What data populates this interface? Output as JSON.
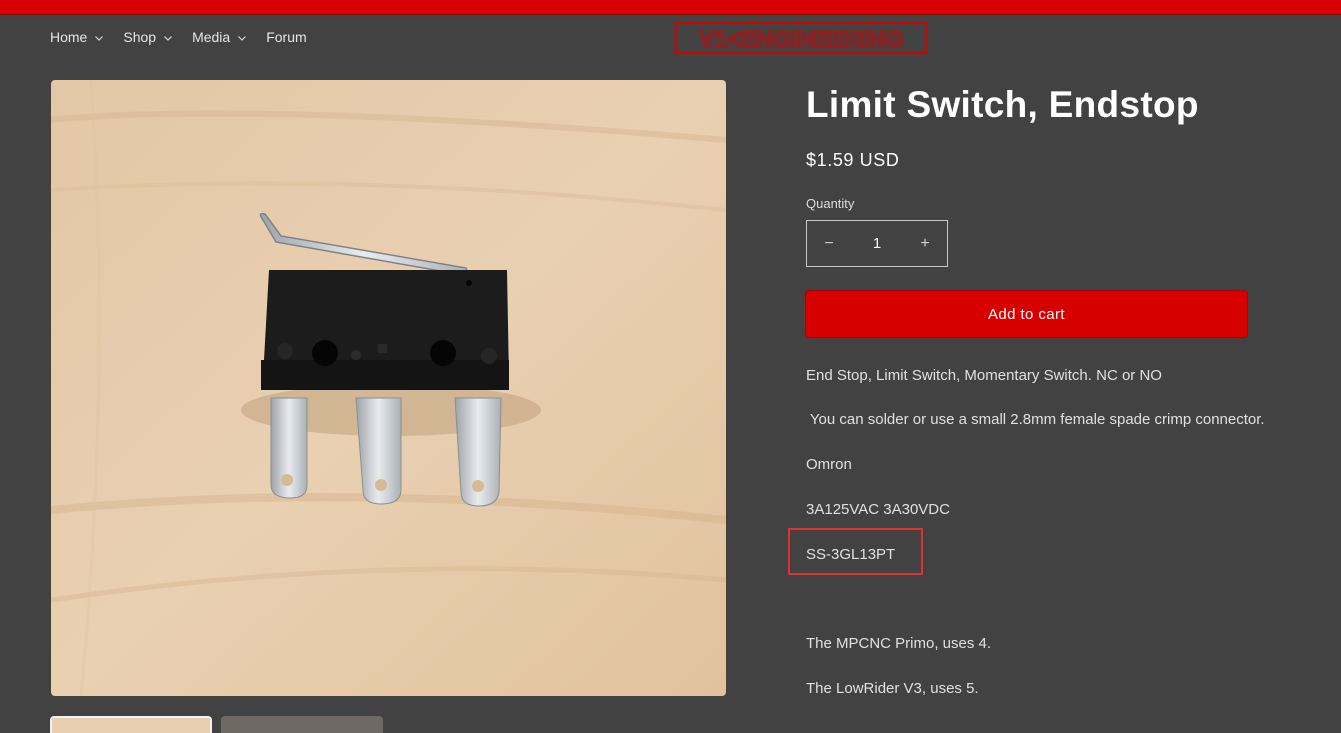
{
  "nav": {
    "items": [
      {
        "label": "Home",
        "has_dropdown": true
      },
      {
        "label": "Shop",
        "has_dropdown": true
      },
      {
        "label": "Media",
        "has_dropdown": true
      },
      {
        "label": "Forum",
        "has_dropdown": false
      }
    ]
  },
  "logo": {
    "text": "V1 ENGINEERING",
    "color": "#d60000"
  },
  "product": {
    "title": "Limit Switch, Endstop",
    "price": "$1.59 USD",
    "quantity_label": "Quantity",
    "quantity_value": "1",
    "decrease_symbol": "−",
    "increase_symbol": "+",
    "add_to_cart_label": "Add to cart",
    "description": [
      "End Stop, Limit Switch, Momentary Switch. NC or NO",
      " You can solder or use a small 2.8mm female spade crimp connector.",
      "Omron",
      "3A125VAC 3A30VDC",
      "SS-3GL13PT",
      "The MPCNC Primo, uses 4.",
      "The LowRider V3, uses 5."
    ]
  },
  "colors": {
    "background": "#424242",
    "accent": "#d60000",
    "highlight": "#e03030"
  },
  "icons": {
    "chevron": "chevron-down-icon",
    "minus": "minus-icon",
    "plus": "plus-icon"
  }
}
